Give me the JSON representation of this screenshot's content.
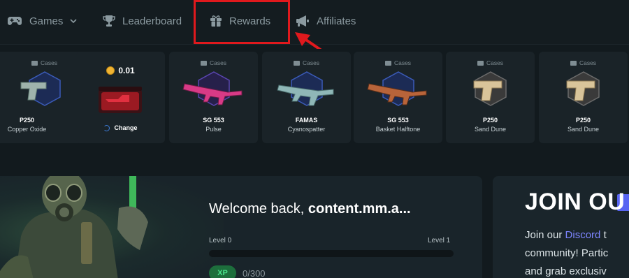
{
  "nav": {
    "items": [
      {
        "label": "Games",
        "icon": "gamepad-icon"
      },
      {
        "label": "Leaderboard",
        "icon": "trophy-icon"
      },
      {
        "label": "Rewards",
        "icon": "gift-icon"
      },
      {
        "label": "Affiliates",
        "icon": "megaphone-icon"
      }
    ]
  },
  "annotation": {
    "highlight_color": "#e0191d"
  },
  "cases_label": "Cases",
  "cards": [
    {
      "name": "P250",
      "skin": "Copper Oxide",
      "color": "#9fb3ac"
    },
    {
      "type": "balance",
      "value": "0.01",
      "action": "Change"
    },
    {
      "name": "SG 553",
      "skin": "Pulse",
      "color": "#e0408a"
    },
    {
      "name": "FAMAS",
      "skin": "Cyanospatter",
      "color": "#8fb7b7"
    },
    {
      "name": "SG 553",
      "skin": "Basket Halftone",
      "color": "#b8643a"
    },
    {
      "name": "P250",
      "skin": "Sand Dune",
      "color": "#d9c49a"
    },
    {
      "name": "P250",
      "skin": "Sand Dune",
      "color": "#d9c49a"
    }
  ],
  "welcome": {
    "prefix": "Welcome back, ",
    "username": "content.mm.a...",
    "level_left": "Level 0",
    "level_right": "Level 1",
    "xp_badge": "XP",
    "xp_value": "0/300",
    "progress": 0
  },
  "join": {
    "title": "JOIN OU",
    "line1_prefix": "Join our ",
    "line1_link": "Discord",
    "line1_suffix": " t",
    "line2": "community! Partic",
    "line3": "and grab exclusiv"
  },
  "colors": {
    "accent_green": "#49e08a",
    "discord": "#7d85ff",
    "coin": "#f0b433"
  }
}
